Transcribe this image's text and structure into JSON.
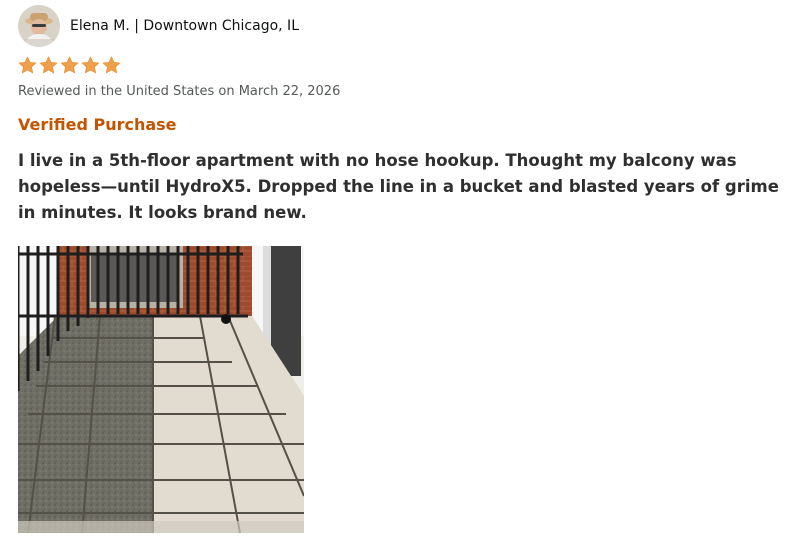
{
  "reviewer": {
    "avatar_icon": "reviewer-avatar",
    "name_location": "Elena M. | Downtown Chicago, IL"
  },
  "rating": {
    "stars": 5,
    "max": 5,
    "star_color": "#f0a04b"
  },
  "review_date": "Reviewed in the United States on March 22, 2026",
  "verified_label": "Verified Purchase",
  "verified_color": "#c45500",
  "review_text": "I live in a 5th-floor apartment with no hose hookup. Thought my balcony was hopeless—until HydroX5. Dropped the line in a bucket and blasted years of grime in minutes. It looks brand new.",
  "photo": {
    "subject": "balcony-floor-before-after"
  }
}
